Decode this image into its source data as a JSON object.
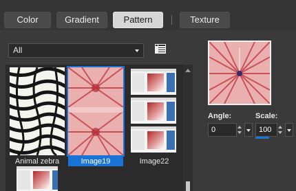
{
  "tabs": [
    {
      "label": "Color",
      "active": false
    },
    {
      "label": "Gradient",
      "active": false
    },
    {
      "label": "Pattern",
      "active": true
    },
    {
      "label": "Texture",
      "active": false
    }
  ],
  "category": {
    "selected": "All"
  },
  "gallery": {
    "items": [
      {
        "label": "Animal zebra",
        "selected": false
      },
      {
        "label": "Image19",
        "selected": true
      },
      {
        "label": "Image22",
        "selected": false
      }
    ]
  },
  "controls": {
    "angle_label": "Angle:",
    "angle_value": "0",
    "scale_label": "Scale:",
    "scale_value": "100"
  },
  "colors": {
    "accent": "#1a74d8",
    "pattern_red": "#b8303a",
    "pattern_pink": "#e8a8a8"
  }
}
